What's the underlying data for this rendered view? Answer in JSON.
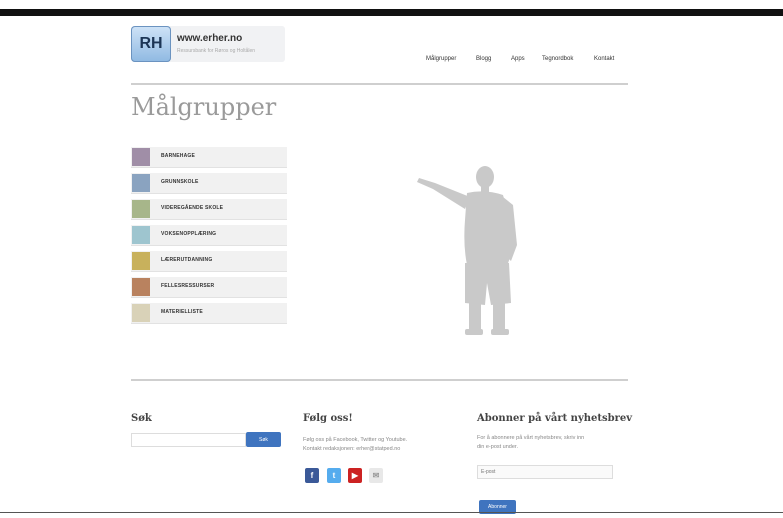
{
  "header": {
    "logo_badge": "RH",
    "logo_url": "www.erher.no",
    "logo_tagline": "Ressursbank for Røros og Holtålen",
    "nav": [
      {
        "label": "Målgrupper"
      },
      {
        "label": "Blogg"
      },
      {
        "label": "Apps"
      },
      {
        "label": "Tegnordbok"
      },
      {
        "label": "Kontakt"
      }
    ]
  },
  "main": {
    "title": "Målgrupper",
    "categories": [
      {
        "label": "BARNEHAGE",
        "color": "#a08ea7"
      },
      {
        "label": "GRUNNSKOLE",
        "color": "#8aa3c0"
      },
      {
        "label": "VIDEREGÅENDE SKOLE",
        "color": "#a7b68a"
      },
      {
        "label": "VOKSENOPPLÆRING",
        "color": "#9ec5cf"
      },
      {
        "label": "LÆRERUTDANNING",
        "color": "#c8b15c"
      },
      {
        "label": "FELLESRESSURSER",
        "color": "#b9825f"
      },
      {
        "label": "MATERIELLISTE",
        "color": "#d9d2b8"
      }
    ]
  },
  "footer": {
    "search": {
      "title": "Søk",
      "placeholder": "",
      "button": "Søk"
    },
    "follow": {
      "title": "Følg oss!",
      "text1": "Følg oss på Facebook, Twitter og Youtube.",
      "text2": "Kontakt redaksjonen: erher@statped.no",
      "icons": [
        "facebook-icon",
        "twitter-icon",
        "youtube-icon",
        "mail-icon"
      ]
    },
    "newsletter": {
      "title": "Abonner på vårt nyhetsbrev",
      "text1": "For å abonnere på vårt nyhetsbrev, skriv inn",
      "text2": "din e-post under.",
      "placeholder": "E-post",
      "button": "Abonner"
    }
  }
}
